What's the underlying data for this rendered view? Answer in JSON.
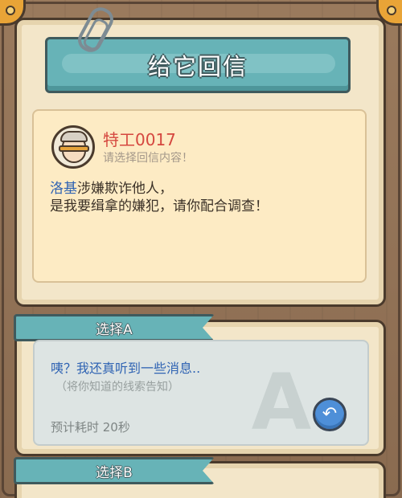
{
  "dialog": {
    "title": "给它回信",
    "agent_name": "特工0017",
    "agent_hint": "请选择回信内容！",
    "message_highlight": "洛基",
    "message_line1_rest": "涉嫌欺诈他人，",
    "message_line2": "是我要缉拿的嫌犯，请你配合调查！"
  },
  "options": [
    {
      "label": "选择A",
      "letter": "A",
      "line1": "咦？我还真听到一些消息..",
      "line2": "（将你知道的线索告知）",
      "time": "预计耗时  20秒",
      "action_icon": "reply-arrow-icon"
    },
    {
      "label": "选择B"
    }
  ],
  "colors": {
    "banner": "#67b3b7",
    "agent_name": "#d5473f",
    "highlight": "#2f63b3",
    "paper": "#fdebc4"
  }
}
